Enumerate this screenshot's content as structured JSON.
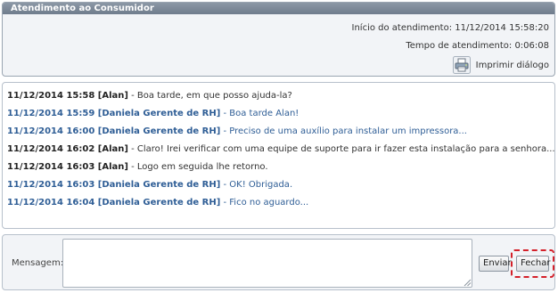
{
  "window": {
    "title": "Atendimento ao Consumidor"
  },
  "header": {
    "start_text": "Início do atendimento: 11/12/2014 15:58:20",
    "elapsed_text": "Tempo de atendimento: 0:06:08",
    "print_label": "Imprimir diálogo",
    "print_icon": "printer-icon"
  },
  "chat": {
    "messages": [
      {
        "stamp": "11/12/2014 15:58 [Alan]",
        "text": " - Boa tarde, em que posso ajuda-la?",
        "sender": "agent"
      },
      {
        "stamp": "11/12/2014 15:59 [Daniela Gerente de RH]",
        "text": " - Boa tarde Alan!",
        "sender": "client"
      },
      {
        "stamp": "11/12/2014 16:00 [Daniela Gerente de RH]",
        "text": " - Preciso de uma auxílio para instalar um impressora...",
        "sender": "client"
      },
      {
        "stamp": "11/12/2014 16:02 [Alan]",
        "text": " - Claro! Irei verificar com uma equipe de suporte para ir fazer esta instalação para a senhora...",
        "sender": "agent"
      },
      {
        "stamp": "11/12/2014 16:03 [Alan]",
        "text": " - Logo em seguida lhe retorno.",
        "sender": "agent"
      },
      {
        "stamp": "11/12/2014 16:03 [Daniela Gerente de RH]",
        "text": " - OK! Obrigada.",
        "sender": "client"
      },
      {
        "stamp": "11/12/2014 16:04 [Daniela Gerente de RH]",
        "text": " - Fico no aguardo...",
        "sender": "client"
      }
    ]
  },
  "composer": {
    "label": "Mensagem:",
    "value": "",
    "send_label": "Enviar",
    "close_label": "Fechar"
  },
  "colors": {
    "title_bar": "#7b8796",
    "client_text": "#2f5e96",
    "highlight": "#d4202a"
  }
}
